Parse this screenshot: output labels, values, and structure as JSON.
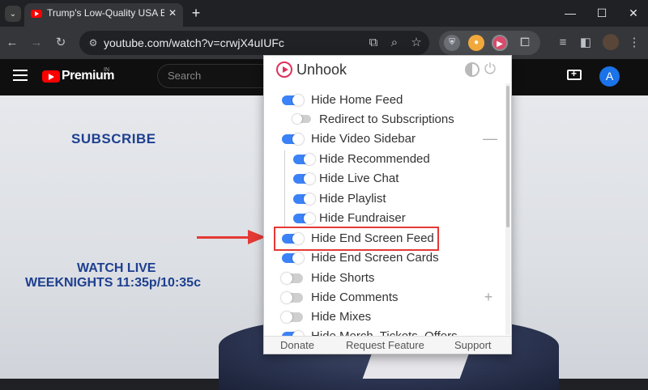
{
  "browser": {
    "tab_title": "Trump's Low-Quality USA Bible",
    "tab_close": "✕",
    "new_tab": "+",
    "url": "youtube.com/watch?v=crwjX4uIUFc",
    "window_controls": {
      "minimize": "—",
      "maximize": "☐",
      "close": "✕"
    }
  },
  "youtube": {
    "brand": "Premium",
    "region": "IN",
    "search_placeholder": "Search",
    "avatar_letter": "A"
  },
  "video": {
    "subscribe": "SUBSCRIBE",
    "watch_live_line1": "WATCH LIVE",
    "watch_live_line2": "WEEKNIGHTS 11:35p/10:35c"
  },
  "popup": {
    "title": "Unhook",
    "items": [
      {
        "label": "Hide Home Feed",
        "on": true
      },
      {
        "label": "Redirect to Subscriptions",
        "on": false
      },
      {
        "label": "Hide Video Sidebar",
        "on": true
      },
      {
        "label": "Hide Recommended",
        "on": true
      },
      {
        "label": "Hide Live Chat",
        "on": true
      },
      {
        "label": "Hide Playlist",
        "on": true
      },
      {
        "label": "Hide Fundraiser",
        "on": true
      },
      {
        "label": "Hide End Screen Feed",
        "on": true
      },
      {
        "label": "Hide End Screen Cards",
        "on": true
      },
      {
        "label": "Hide Shorts",
        "on": false
      },
      {
        "label": "Hide Comments",
        "on": false
      },
      {
        "label": "Hide Mixes",
        "on": false
      },
      {
        "label": "Hide Merch, Tickets, Offers",
        "on": true
      }
    ],
    "collapse_symbol": "—",
    "expand_symbol": "+",
    "footer": {
      "donate": "Donate",
      "request_feature": "Request Feature",
      "support": "Support"
    }
  },
  "colors": {
    "toggle_on": "#3b82f6",
    "toggle_off": "#cfcfcf",
    "highlight": "#e53935",
    "brand_red": "#ff0000"
  }
}
